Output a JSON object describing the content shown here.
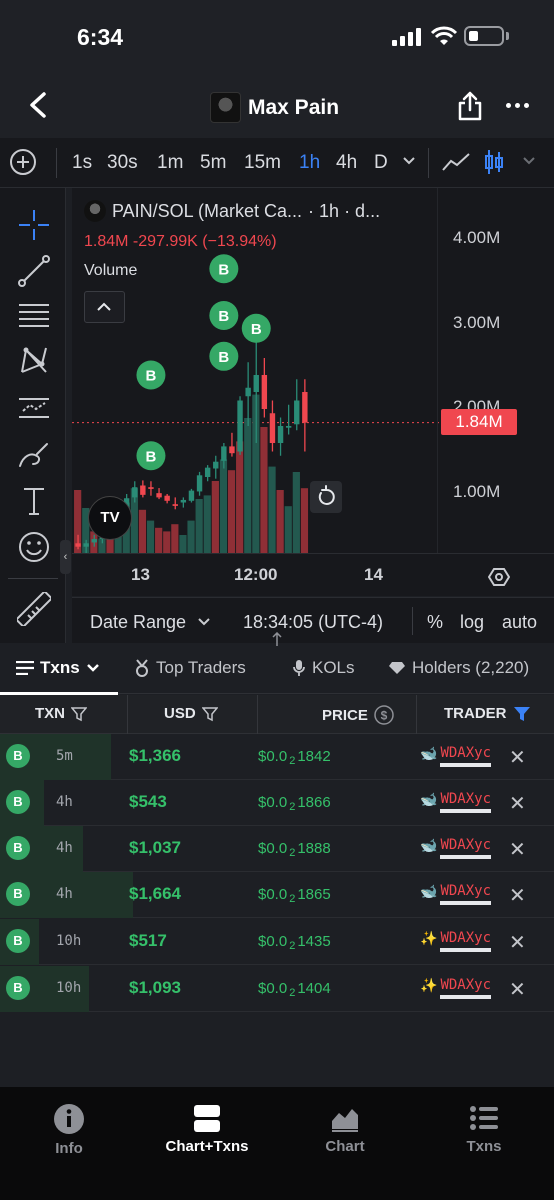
{
  "status": {
    "time": "6:34"
  },
  "header": {
    "title": "Max Pain"
  },
  "toolbar": {
    "timeframes": [
      "1s",
      "30s",
      "1m",
      "5m",
      "15m",
      "1h",
      "4h",
      "D"
    ],
    "active_timeframe": "1h"
  },
  "chart": {
    "legend_title": "PAIN/SOL (Market Ca...",
    "legend_suffix": "· 1h · d...",
    "legend_values": "1.84M  -297.99K (−13.94%)",
    "volume_label": "Volume",
    "tv_logo": "TV",
    "price_tag": "1.84M",
    "badge_label": "B",
    "colors": {
      "up": "#2a8c77",
      "down": "#f0474f",
      "buy_badge": "#35a866"
    }
  },
  "chart_data": {
    "type": "candlestick",
    "title": "PAIN/SOL (Market Ca...",
    "y_tick_labels": [
      "4.00M",
      "3.00M",
      "2.00M",
      "1.00M"
    ],
    "x_tick_labels": [
      "13",
      "12:00",
      "14"
    ],
    "last_price": "1.84M",
    "ylim": [
      0,
      4300000
    ],
    "candles": [
      {
        "o": 420000,
        "h": 520000,
        "l": 350000,
        "c": 380000
      },
      {
        "o": 380000,
        "h": 460000,
        "l": 300000,
        "c": 420000
      },
      {
        "o": 430000,
        "h": 520000,
        "l": 380000,
        "c": 470000
      },
      {
        "o": 470000,
        "h": 560000,
        "l": 420000,
        "c": 510000
      },
      {
        "o": 520000,
        "h": 620000,
        "l": 460000,
        "c": 560000
      },
      {
        "o": 560000,
        "h": 700000,
        "l": 510000,
        "c": 680000
      },
      {
        "o": 700000,
        "h": 1000000,
        "l": 640000,
        "c": 950000
      },
      {
        "o": 960000,
        "h": 1150000,
        "l": 900000,
        "c": 1080000
      },
      {
        "o": 1100000,
        "h": 1160000,
        "l": 960000,
        "c": 990000
      },
      {
        "o": 1080000,
        "h": 1150000,
        "l": 980000,
        "c": 1060000
      },
      {
        "o": 1010000,
        "h": 1070000,
        "l": 940000,
        "c": 960000
      },
      {
        "o": 980000,
        "h": 1000000,
        "l": 890000,
        "c": 920000
      },
      {
        "o": 880000,
        "h": 960000,
        "l": 820000,
        "c": 860000
      },
      {
        "o": 900000,
        "h": 960000,
        "l": 840000,
        "c": 930000
      },
      {
        "o": 920000,
        "h": 1060000,
        "l": 900000,
        "c": 1040000
      },
      {
        "o": 1030000,
        "h": 1260000,
        "l": 980000,
        "c": 1220000
      },
      {
        "o": 1200000,
        "h": 1340000,
        "l": 1150000,
        "c": 1310000
      },
      {
        "o": 1300000,
        "h": 1450000,
        "l": 1180000,
        "c": 1380000
      },
      {
        "o": 1390000,
        "h": 1600000,
        "l": 1300000,
        "c": 1560000
      },
      {
        "o": 1560000,
        "h": 1720000,
        "l": 1440000,
        "c": 1480000
      },
      {
        "o": 1500000,
        "h": 2150000,
        "l": 1460000,
        "c": 2100000
      },
      {
        "o": 2150000,
        "h": 2550000,
        "l": 1800000,
        "c": 2250000
      },
      {
        "o": 2200000,
        "h": 3100000,
        "l": 1600000,
        "c": 2400000
      },
      {
        "o": 2400000,
        "h": 2600000,
        "l": 1900000,
        "c": 2000000
      },
      {
        "o": 1950000,
        "h": 2100000,
        "l": 1500000,
        "c": 1600000
      },
      {
        "o": 1600000,
        "h": 1900000,
        "l": 1450000,
        "c": 1800000
      },
      {
        "o": 1780000,
        "h": 2050000,
        "l": 1700000,
        "c": 1800000
      },
      {
        "o": 1820000,
        "h": 2350000,
        "l": 1750000,
        "c": 2100000
      },
      {
        "o": 2200000,
        "h": 2350000,
        "l": 1500000,
        "c": 1840000
      }
    ],
    "volumes": [
      {
        "v": 35,
        "up": false
      },
      {
        "v": 25,
        "up": true
      },
      {
        "v": 12,
        "up": false
      },
      {
        "v": 8,
        "up": true
      },
      {
        "v": 10,
        "up": false
      },
      {
        "v": 12,
        "up": true
      },
      {
        "v": 28,
        "up": true
      },
      {
        "v": 36,
        "up": true
      },
      {
        "v": 24,
        "up": false
      },
      {
        "v": 18,
        "up": true
      },
      {
        "v": 14,
        "up": false
      },
      {
        "v": 12,
        "up": false
      },
      {
        "v": 16,
        "up": false
      },
      {
        "v": 10,
        "up": true
      },
      {
        "v": 18,
        "up": true
      },
      {
        "v": 30,
        "up": true
      },
      {
        "v": 32,
        "up": true
      },
      {
        "v": 40,
        "up": false
      },
      {
        "v": 52,
        "up": true
      },
      {
        "v": 46,
        "up": false
      },
      {
        "v": 62,
        "up": false
      },
      {
        "v": 75,
        "up": true
      },
      {
        "v": 88,
        "up": true
      },
      {
        "v": 70,
        "up": false
      },
      {
        "v": 48,
        "up": true
      },
      {
        "v": 35,
        "up": false
      },
      {
        "v": 26,
        "up": true
      },
      {
        "v": 45,
        "up": true
      },
      {
        "v": 36,
        "up": false
      }
    ],
    "buy_markers": [
      {
        "candle": 9,
        "price": 1450000
      },
      {
        "candle": 9,
        "price": 2400000
      },
      {
        "candle": 18,
        "price": 3650000
      },
      {
        "candle": 18,
        "price": 3100000
      },
      {
        "candle": 18,
        "price": 2620000
      },
      {
        "candle": 22,
        "price": 2950000
      }
    ]
  },
  "rangebar": {
    "date_range": "Date Range",
    "clock": "18:34:05 (UTC-4)",
    "percent": "%",
    "log": "log",
    "auto": "auto"
  },
  "tabs": {
    "txns": "Txns",
    "top_traders": "Top Traders",
    "kols": "KOLs",
    "holders": "Holders (2,220)"
  },
  "table": {
    "headers": {
      "txn": "TXN",
      "usd": "USD",
      "price": "PRICE",
      "trader": "TRADER"
    },
    "rows": [
      {
        "type": "B",
        "age": "5m",
        "usd": "$1,366",
        "price_prefix": "$0.0",
        "price_zeros": "2",
        "price_digits": "1842",
        "trader": "WDAXyc",
        "trader_icon": "whale-icon",
        "bar_fill": 0.2
      },
      {
        "type": "B",
        "age": "4h",
        "usd": "$543",
        "price_prefix": "$0.0",
        "price_zeros": "2",
        "price_digits": "1866",
        "trader": "WDAXyc",
        "trader_icon": "whale-icon",
        "bar_fill": 0.08
      },
      {
        "type": "B",
        "age": "4h",
        "usd": "$1,037",
        "price_prefix": "$0.0",
        "price_zeros": "2",
        "price_digits": "1888",
        "trader": "WDAXyc",
        "trader_icon": "whale-icon",
        "bar_fill": 0.15
      },
      {
        "type": "B",
        "age": "4h",
        "usd": "$1,664",
        "price_prefix": "$0.0",
        "price_zeros": "2",
        "price_digits": "1865",
        "trader": "WDAXyc",
        "trader_icon": "whale-icon",
        "bar_fill": 0.24
      },
      {
        "type": "B",
        "age": "10h",
        "usd": "$517",
        "price_prefix": "$0.0",
        "price_zeros": "2",
        "price_digits": "1435",
        "trader": "WDAXyc",
        "trader_icon": "sparkle-whale-icon",
        "bar_fill": 0.07
      },
      {
        "type": "B",
        "age": "10h",
        "usd": "$1,093",
        "price_prefix": "$0.0",
        "price_zeros": "2",
        "price_digits": "1404",
        "trader": "WDAXyc",
        "trader_icon": "sparkle-whale-icon",
        "bar_fill": 0.16
      }
    ]
  },
  "bottom_nav": {
    "info": "Info",
    "chart_txns": "Chart+Txns",
    "chart": "Chart",
    "txns": "Txns",
    "active": "Chart+Txns"
  }
}
